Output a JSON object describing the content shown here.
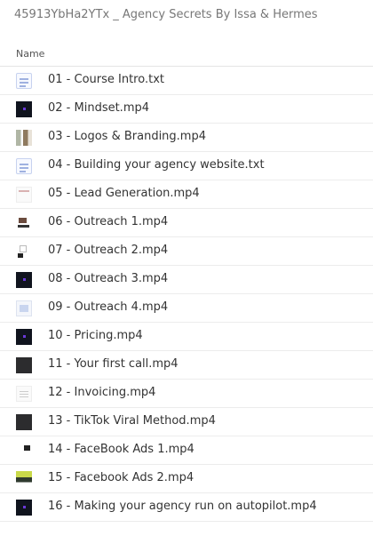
{
  "window": {
    "title": "45913YbHa2YTx _ Agency Secrets By Issa & Hermes"
  },
  "table": {
    "column_header": "Name",
    "rows": [
      {
        "name": "01 - Course Intro.txt",
        "thumbnail": "text-file-icon"
      },
      {
        "name": "02 - Mindset.mp4",
        "thumbnail": "video-thumbnail-dark"
      },
      {
        "name": "03 - Logos & Branding.mp4",
        "thumbnail": "video-thumbnail-logos"
      },
      {
        "name": "04 - Building your agency website.txt",
        "thumbnail": "text-file-icon"
      },
      {
        "name": "05 - Lead Generation.mp4",
        "thumbnail": "video-thumbnail-light"
      },
      {
        "name": "06 - Outreach 1.mp4",
        "thumbnail": "video-thumbnail-mixed"
      },
      {
        "name": "07 - Outreach 2.mp4",
        "thumbnail": "video-thumbnail-mixed"
      },
      {
        "name": "08 - Outreach 3.mp4",
        "thumbnail": "video-thumbnail-dark"
      },
      {
        "name": "09 - Outreach 4.mp4",
        "thumbnail": "video-thumbnail-document"
      },
      {
        "name": "10 - Pricing.mp4",
        "thumbnail": "video-thumbnail-dark"
      },
      {
        "name": "11 - Your first call.mp4",
        "thumbnail": "video-thumbnail-dark-gray"
      },
      {
        "name": "12 - Invoicing.mp4",
        "thumbnail": "video-thumbnail-invoice"
      },
      {
        "name": "13 - TikTok Viral Method.mp4",
        "thumbnail": "video-thumbnail-dark-gray"
      },
      {
        "name": "14 - FaceBook Ads 1.mp4",
        "thumbnail": "video-thumbnail-fb"
      },
      {
        "name": "15 - Facebook Ads 2.mp4",
        "thumbnail": "video-thumbnail-fb-green"
      },
      {
        "name": "16 - Making your agency run on autopilot.mp4",
        "thumbnail": "video-thumbnail-dark"
      }
    ]
  }
}
